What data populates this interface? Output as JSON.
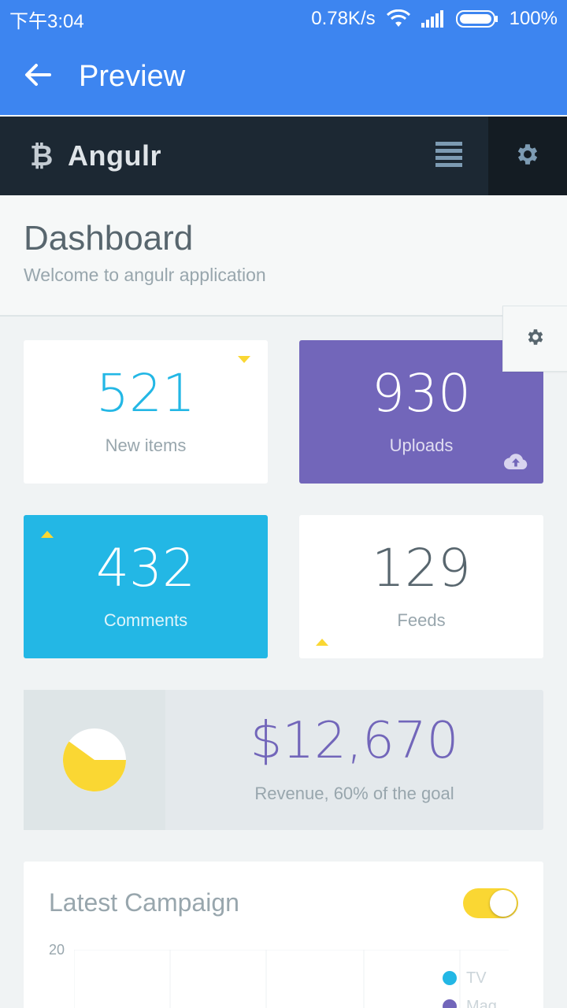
{
  "status_bar": {
    "time": "下午3:04",
    "speed": "0.78K/s",
    "battery": "100%"
  },
  "app_bar": {
    "title": "Preview"
  },
  "header": {
    "brand_icon": "₿",
    "brand_name": "Angulr"
  },
  "dashboard": {
    "title": "Dashboard",
    "subtitle": "Welcome to angulr application"
  },
  "tiles": [
    {
      "value": "521",
      "label": "New items"
    },
    {
      "value": "930",
      "label": "Uploads"
    },
    {
      "value": "432",
      "label": "Comments"
    },
    {
      "value": "129",
      "label": "Feeds"
    }
  ],
  "revenue": {
    "amount": "$12,670",
    "caption": "Revenue, 60% of the goal",
    "goal_fraction": 0.6
  },
  "campaign": {
    "title": "Latest Campaign",
    "toggle_on": true,
    "y_tick": "20",
    "legend": [
      {
        "label": "TV",
        "color": "#23b7e5"
      },
      {
        "label": "Mag",
        "color": "#7266ba"
      }
    ]
  },
  "colors": {
    "primary": "#3d85f0",
    "info": "#23b7e5",
    "purple": "#7266ba",
    "warning": "#fad733",
    "dark": "#1c2833"
  },
  "icons": [
    "back-arrow-icon",
    "wifi-icon",
    "signal-icon",
    "battery-icon",
    "bitcoin-icon",
    "menu-icon",
    "gear-icon",
    "cloud-upload-icon",
    "caret-icon",
    "pie-chart-icon"
  ]
}
